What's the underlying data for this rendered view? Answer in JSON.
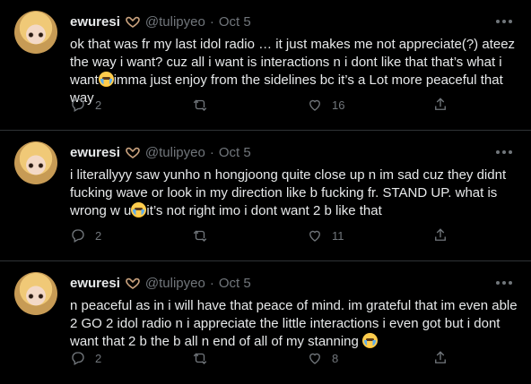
{
  "tweets": [
    {
      "author": {
        "name": "ewuresi",
        "handle": "@tulipyeo"
      },
      "date": "Oct 5",
      "segments": [
        {
          "type": "text",
          "value": "ok that was fr my last idol radio … it just makes me not appreciate(?) ateez the way i want? cuz all i want is interactions n i dont like that that’s what i want"
        },
        {
          "type": "emoji",
          "name": "loudly-crying-emoji"
        },
        {
          "type": "text",
          "value": "imma just enjoy from the sidelines bc it’s a Lot more peaceful that way"
        }
      ],
      "metrics": {
        "replies": "2",
        "retweets": "",
        "likes": "16"
      }
    },
    {
      "author": {
        "name": "ewuresi",
        "handle": "@tulipyeo"
      },
      "date": "Oct 5",
      "segments": [
        {
          "type": "text",
          "value": "i literallyyy saw yunho n hongjoong quite close up n im sad cuz they didnt fucking wave or look in my direction like b fucking fr. STAND UP. what is wrong w u"
        },
        {
          "type": "emoji",
          "name": "loudly-crying-emoji"
        },
        {
          "type": "text",
          "value": "it’s not right imo i dont want 2 b like that"
        }
      ],
      "metrics": {
        "replies": "2",
        "retweets": "",
        "likes": "11"
      }
    },
    {
      "author": {
        "name": "ewuresi",
        "handle": "@tulipyeo"
      },
      "date": "Oct 5",
      "segments": [
        {
          "type": "text",
          "value": "n peaceful as in i will have that peace of mind. im grateful that im even able 2 GO 2 idol radio n i appreciate the little interactions i even got but i dont want that 2 b the b all n end of all of my stanning "
        },
        {
          "type": "emoji",
          "name": "loudly-crying-emoji"
        }
      ],
      "metrics": {
        "replies": "2",
        "retweets": "",
        "likes": "8"
      }
    }
  ],
  "dot_separator": "·",
  "colors": {
    "background": "#000000",
    "text": "#e7e9ea",
    "muted": "#71767b",
    "divider": "#2f3336",
    "heart_hands": "#c9a27e"
  }
}
